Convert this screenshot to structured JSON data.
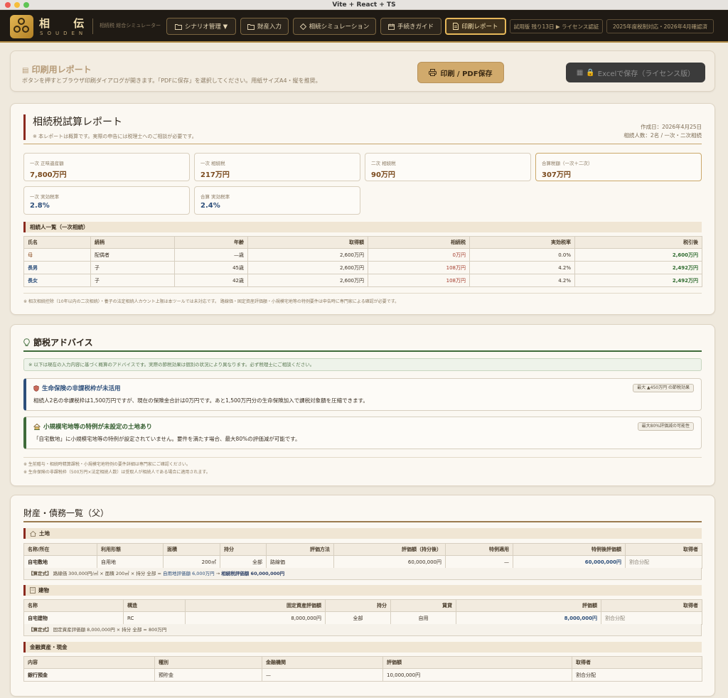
{
  "window": {
    "title": "Vite + React + TS"
  },
  "header": {
    "brand": "相 伝",
    "brand_sub": "SOUDEN",
    "tagline": "相続税 総合シミュレーター",
    "nav": [
      {
        "label": "シナリオ管理 ▼"
      },
      {
        "label": "財産入力"
      },
      {
        "label": "相続シミュレーション"
      },
      {
        "label": "手続きガイド"
      },
      {
        "label": "印刷レポート"
      }
    ],
    "trial": "試用版 残り13日 ▶ ライセンス認証",
    "tax_year": "2025年度税制対応・2026年4月確認済"
  },
  "print": {
    "title": "印刷用レポート",
    "desc": "ボタンを押すとブラウザ印刷ダイアログが開きます。「PDFに保存」を選択してください。用紙サイズA4・縦を推奨。",
    "print_label": "印刷 / PDF保存",
    "excel_label": "Excelで保存（ライセンス版）"
  },
  "report": {
    "title": "相続税試算レポート",
    "subtitle": "※ 本レポートは概算です。実際の申告には税理士へのご相談が必要です。",
    "date": "作成日：2026年4月25日",
    "heirs_info": "相続人数：2名 / 一次・二次相続",
    "kpis": [
      {
        "label": "一次 正味遺産額",
        "value": "7,800万円"
      },
      {
        "label": "一次 相続税",
        "value": "217万円"
      },
      {
        "label": "二次 相続税",
        "value": "90万円"
      },
      {
        "label": "合算税額（一次＋二次）",
        "value": "307万円"
      },
      {
        "label": "一次 実効税率",
        "value": "2.8%"
      },
      {
        "label": "合算 実効税率",
        "value": "2.4%"
      }
    ],
    "heirs_title": "相続人一覧（一次相続）",
    "heirs_cols": [
      "氏名",
      "続柄",
      "年齢",
      "取得額",
      "相続税",
      "実効税率",
      "税引後"
    ],
    "heirs_rows": [
      [
        "母",
        "配偶者",
        "—歳",
        "2,600万円",
        "0万円",
        "0.0%",
        "2,600万円"
      ],
      [
        "長男",
        "子",
        "45歳",
        "2,600万円",
        "108万円",
        "4.2%",
        "2,492万円"
      ],
      [
        "長女",
        "子",
        "42歳",
        "2,600万円",
        "108万円",
        "4.2%",
        "2,492万円"
      ]
    ],
    "footnote": "※ 相次相続控除（10年以内の二次相続）・養子の法定相続人カウント上限は本ツールでは未対応です。 路線価・固定資産評価額・小規模宅地等の特例要件は申告時に専門家による確認が必要です。"
  },
  "advice": {
    "title": "節税アドバイス",
    "note": "※ 以下は現在の入力内容に基づく概算のアドバイスです。実際の節税効果は個別の状況により異なります。必ず税理士にご相談ください。",
    "tips": [
      {
        "title": "生命保険の非課税枠が未活用",
        "body": "相続人2名の非課税枠は1,500万円ですが、現在の保険金合計は0万円です。あと1,500万円分の生命保険加入で課税対象額を圧縮できます。",
        "badge": "最大 ▲450万円 の節税効果"
      },
      {
        "title": "小規模宅地等の特例が未設定の土地あり",
        "body": "「自宅敷地」に小規模宅地等の特例が設定されていません。要件を満たす場合、最大80%の評価減が可能です。",
        "badge": "最大80%評価減の可能性"
      }
    ],
    "foot1": "※ 生前贈与・相続時精算課税・小規模宅地特例の要件詳細は専門家にご確認ください。",
    "foot2": "※ 生命保険の非課税枠（500万円×法定相続人数）は受取人が相続人である場合に適用されます。"
  },
  "assets": {
    "title": "財産・債務一覧（父）",
    "land": {
      "title": "土地",
      "cols": [
        "名称/所在",
        "利用形態",
        "面積",
        "持分",
        "評価方法",
        "評価額（持分後）",
        "特例適用",
        "特例後評価額",
        "取得者"
      ],
      "row": [
        "自宅敷地",
        "自用地",
        "200㎡",
        "全部",
        "路線価",
        "60,000,000円",
        "—",
        "60,000,000円",
        "割合分配"
      ],
      "calc_prefix": "【算定式】",
      "calc_body": "路線価 300,000円/㎡ × 面積 200㎡ × 持分 全部 =",
      "calc_hl": "自用地評価額 6,000万円",
      "calc_arrow": "→",
      "calc_final": "相続税評価額 60,000,000円"
    },
    "building": {
      "title": "建物",
      "cols": [
        "名称",
        "構造",
        "固定資産評価額",
        "持分",
        "賃貸",
        "評価額",
        "取得者"
      ],
      "row": [
        "自宅建物",
        "RC",
        "8,000,000円",
        "全部",
        "自用",
        "8,000,000円",
        "割合分配"
      ],
      "calc_prefix": "【算定式】",
      "calc_body": "固定資産評価額 8,000,000円 × 持分 全部 = 800万円"
    },
    "financial": {
      "title": "金融資産・現金",
      "cols": [
        "内容",
        "種別",
        "金融機関",
        "評価額",
        "取得者"
      ],
      "row": [
        "銀行預金",
        "預貯金",
        "—",
        "10,000,000円",
        "割合分配"
      ]
    }
  },
  "colors": {
    "accent": "#b08a45",
    "header_bg": "#1f1a14",
    "primary_red": "#8b2a1f",
    "blue": "#2d4f7b",
    "green": "#3f6b3a"
  }
}
